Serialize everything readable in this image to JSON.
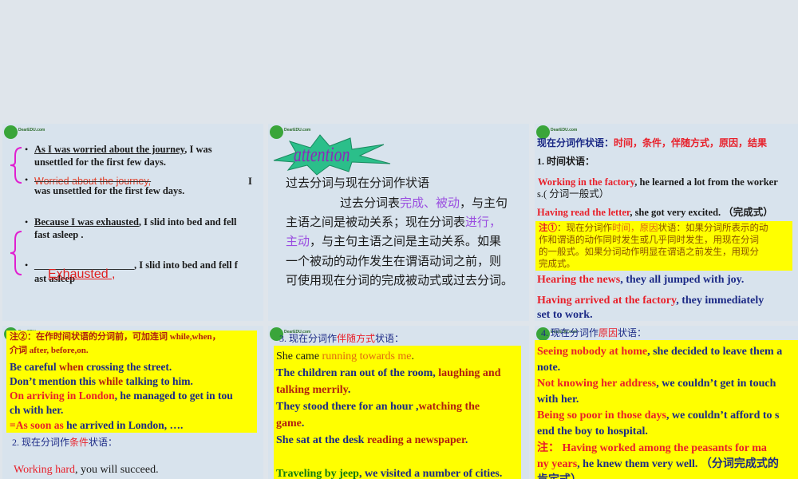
{
  "logo_text": "DearEDU.com",
  "attention_label": "attention",
  "slides": [
    {
      "lines": [
        [
          [
            "As I was worried about the journey",
            "k u"
          ],
          [
            ", I was",
            "k"
          ]
        ],
        [
          [
            "unsettled for the first few days.",
            "k"
          ]
        ],
        [
          [
            "Worried about the journey,",
            "strike"
          ]
        ],
        [
          [
            "I",
            "k"
          ]
        ],
        [
          [
            "was unsettled for the first few days.",
            "k"
          ]
        ],
        [
          [
            "Because I was exhausted",
            "k u"
          ],
          [
            ", I slid into bed and fell",
            "k"
          ]
        ],
        [
          [
            "fast asleep .",
            "k"
          ]
        ],
        [
          [
            "____________________,   I slid into bed and fell f",
            "k"
          ]
        ],
        [
          [
            "ast asleep",
            "k"
          ]
        ],
        [
          [
            "Exhausted ,",
            "big"
          ]
        ]
      ]
    },
    {
      "lines": [
        [
          [
            "过去分词与现在分词作状语",
            "k cjk"
          ]
        ],
        [
          [
            "过去分词表",
            "k cjk"
          ],
          [
            "完成、被动",
            "p cjk"
          ],
          [
            "，与主句",
            "k cjk"
          ]
        ],
        [
          [
            "主语之间是被动关系；现在分词表",
            "k cjk"
          ],
          [
            "进行，",
            "p cjk"
          ]
        ],
        [
          [
            "主动",
            "p cjk"
          ],
          [
            "，与主句主语之间是主动关系。如果",
            "k cjk"
          ]
        ],
        [
          [
            "一个被动的动作发生在谓语动词之前，则",
            "k cjk"
          ]
        ],
        [
          [
            "可使用现在分词的完成被动式或过去分词。",
            "k cjk"
          ]
        ]
      ]
    },
    {
      "lines": [
        [
          [
            "现在分词作状语：",
            "b"
          ],
          [
            "时间，条件，伴随方式，原因，结果",
            "r"
          ]
        ],
        [
          [
            "1. 时间状语：",
            "k"
          ]
        ],
        [
          [
            " Working in the factory",
            "r"
          ],
          [
            ", he learned a lot from the    worker",
            "k"
          ]
        ],
        [
          [
            "s.( 分词一般式）",
            "k n"
          ]
        ],
        [
          [
            "Having read the letter",
            "r"
          ],
          [
            ", she got very excited. （完成式）",
            "k"
          ]
        ],
        [
          [
            "注①",
            "r"
          ],
          [
            "：现在分词作",
            "ol n"
          ],
          [
            "时间，原因",
            "o n"
          ],
          [
            "状语：如果分词所表示的动",
            "ol n"
          ]
        ],
        [
          [
            "作和谓语的动作同时发生或几乎同时发生，用现在分词",
            "ol n"
          ]
        ],
        [
          [
            "的一般式。如果分词动作明显在谓语之前发生，用现分",
            "ol n"
          ]
        ],
        [
          [
            "完成式。",
            "ol n"
          ]
        ],
        [
          [
            "Hearing the news",
            "r"
          ],
          [
            ", they all jumped with joy.",
            "b"
          ]
        ],
        [
          [
            "Having arrived at the factory",
            "r"
          ],
          [
            ", they immediately",
            "b"
          ]
        ],
        [
          [
            "set to work.",
            "b"
          ]
        ]
      ]
    },
    {
      "lines": [
        [
          [
            "注②：在作时间状语的分词前，可加连词 while,when，",
            "br"
          ]
        ],
        [
          [
            "介词 after, before,on.",
            "br"
          ]
        ],
        [
          [
            "Be careful ",
            "b"
          ],
          [
            "when",
            "br"
          ],
          [
            " crossing the street.",
            "b"
          ]
        ],
        [
          [
            " Don’t mention this ",
            "b"
          ],
          [
            "while",
            "br"
          ],
          [
            " talking to him.",
            "b"
          ]
        ],
        [
          [
            "On arriving in London",
            "r"
          ],
          [
            ", he managed to get in tou",
            "b"
          ]
        ],
        [
          [
            "ch with her.",
            "b"
          ]
        ],
        [
          [
            "=As soon as",
            "r"
          ],
          [
            " he arrived in London, ….",
            "b"
          ]
        ],
        [
          [
            "2. 现在分词作",
            "b n"
          ],
          [
            "条件",
            "r n"
          ],
          [
            "状语：",
            "b n"
          ]
        ],
        [
          [
            "Working hard",
            "r n"
          ],
          [
            ", you will succeed.",
            "k n"
          ]
        ]
      ]
    },
    {
      "lines": [
        [
          [
            "3. 现在分词作",
            "b n"
          ],
          [
            "伴随方式",
            "r n"
          ],
          [
            "状语：",
            "b n"
          ]
        ],
        [
          [
            "She came ",
            "k n"
          ],
          [
            "running towards me",
            "o n"
          ],
          [
            ".",
            "k n"
          ]
        ],
        [
          [
            "The children ran out of the room, ",
            "b"
          ],
          [
            "laughing and",
            "br"
          ]
        ],
        [
          [
            "talking merrily",
            "br"
          ],
          [
            ".",
            "b"
          ]
        ],
        [
          [
            "They  stood  there  for  an  hour  ,",
            "b"
          ],
          [
            "watching  the",
            "br"
          ]
        ],
        [
          [
            "game",
            "br"
          ],
          [
            ".",
            "b"
          ]
        ],
        [
          [
            " She sat at the desk ",
            "b"
          ],
          [
            "reading a newspaper",
            "br"
          ],
          [
            ".",
            "b"
          ]
        ],
        [
          [
            "Traveling by jeep",
            "g"
          ],
          [
            ", we visited a number of cities.",
            "b"
          ]
        ]
      ]
    },
    {
      "lines": [
        [
          [
            "4. 现在分词作",
            "b n"
          ],
          [
            "原因",
            "r n"
          ],
          [
            "状语：",
            "b n"
          ]
        ],
        [
          [
            "Seeing nobody at home",
            "r"
          ],
          [
            ", she decided to leave them a",
            "b"
          ]
        ],
        [
          [
            "note.",
            "b"
          ]
        ],
        [
          [
            "Not knowing her address",
            "r"
          ],
          [
            ", we couldn’t get in touch",
            "b"
          ]
        ],
        [
          [
            "with her.",
            "b"
          ]
        ],
        [
          [
            "Being so poor in those days",
            "r"
          ],
          [
            ", we couldn’t afford to s",
            "b"
          ]
        ],
        [
          [
            "end the boy to hospital.",
            "b"
          ]
        ],
        [
          [
            "注：      Having worked among the peasants for ma",
            "r"
          ]
        ],
        [
          [
            "ny years",
            "r"
          ],
          [
            ", he knew them very well. （分词完成式的",
            "b"
          ]
        ],
        [
          [
            "肯定式）",
            "b"
          ]
        ]
      ]
    }
  ]
}
